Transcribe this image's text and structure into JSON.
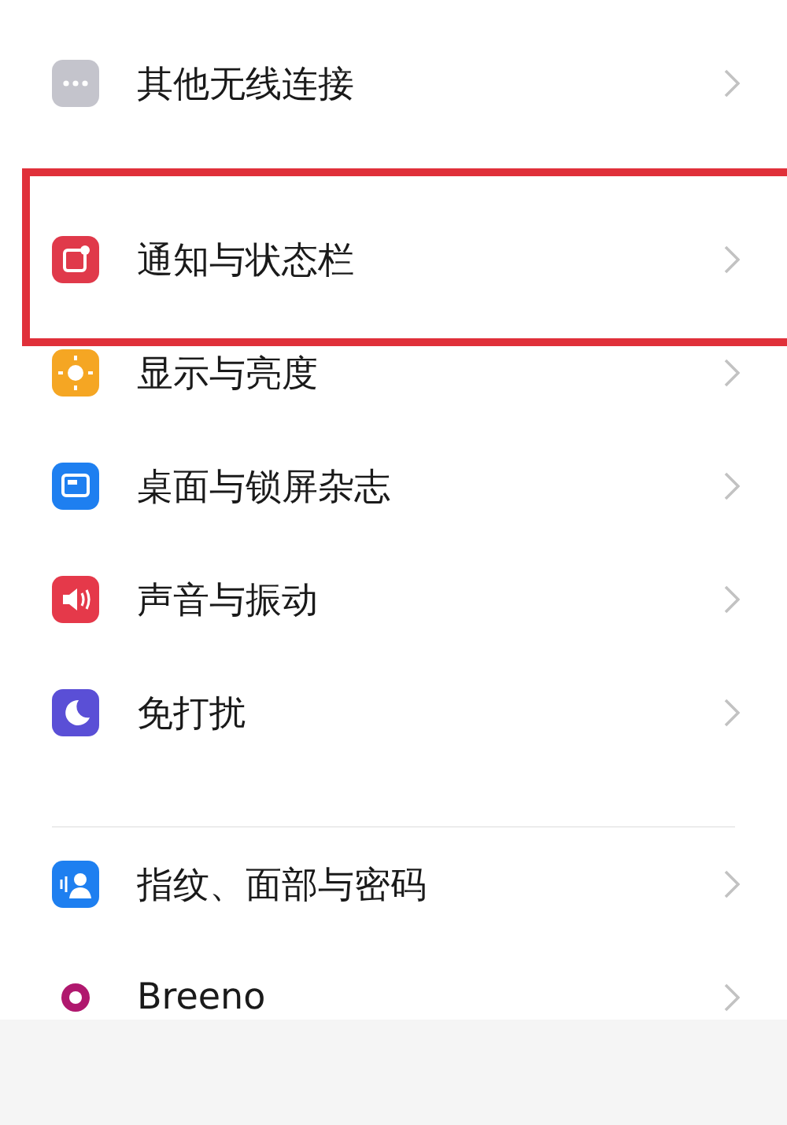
{
  "groups": [
    {
      "items": [
        {
          "kind": "more",
          "label": "其他无线连接",
          "highlighted": false
        },
        {
          "kind": "notification",
          "label": "通知与状态栏",
          "highlighted": true
        },
        {
          "kind": "sun",
          "label": "显示与亮度",
          "highlighted": false
        },
        {
          "kind": "wallpaper",
          "label": "桌面与锁屏杂志",
          "highlighted": false
        },
        {
          "kind": "sound",
          "label": "声音与振动",
          "highlighted": false
        },
        {
          "kind": "moon",
          "label": "免打扰",
          "highlighted": false
        }
      ]
    },
    {
      "items": [
        {
          "kind": "face",
          "label": "指纹、面部与密码",
          "highlighted": false
        },
        {
          "kind": "ring",
          "label": "Breeno",
          "highlighted": false
        }
      ]
    }
  ]
}
